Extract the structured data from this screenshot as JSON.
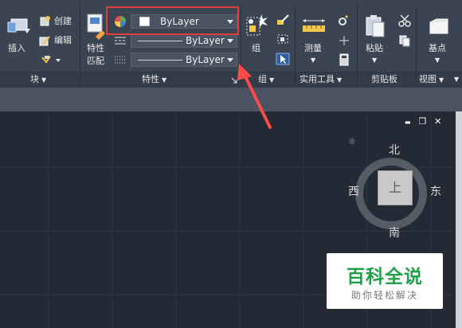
{
  "panels": {
    "block": {
      "title": "块",
      "insert_label": "插入",
      "create_label": "创建",
      "edit_label": "编辑"
    },
    "properties": {
      "title": "特性",
      "match_label_1": "特性",
      "match_label_2": "匹配"
    },
    "groups": {
      "title": "组",
      "group_label": "组"
    },
    "utilities": {
      "title": "实用工具",
      "measure_label": "测量"
    },
    "clipboard": {
      "title": "剪贴板",
      "paste_label": "粘贴"
    },
    "view": {
      "title": "视图",
      "base_label": "基点"
    }
  },
  "properties_dropdowns": {
    "color": {
      "value": "ByLayer"
    },
    "linetype": {
      "value": "ByLayer"
    },
    "lineweight": {
      "value": "ByLayer"
    }
  },
  "viewcube": {
    "north": "北",
    "south": "南",
    "east": "东",
    "west": "西",
    "face": "上"
  },
  "window_controls": {
    "minimize": "▬",
    "restore": "❐",
    "close": "✕"
  },
  "watermark": {
    "title": "百科全说",
    "subtitle": "助你轻松解决"
  },
  "colors": {
    "highlight_box": "#e23b3b",
    "arrow": "#ff4a4a",
    "watermark_green": "#21a049"
  }
}
